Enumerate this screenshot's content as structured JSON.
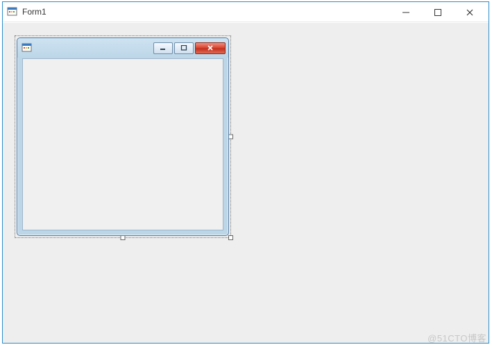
{
  "outer_window": {
    "title": "Form1",
    "icon_name": "winforms-app-icon",
    "controls": {
      "minimize_tooltip": "Minimize",
      "maximize_tooltip": "Maximize",
      "close_tooltip": "Close"
    }
  },
  "inner_window": {
    "title": "",
    "icon_name": "winforms-app-icon",
    "controls": {
      "minimize_tooltip": "Minimize",
      "maximize_tooltip": "Maximize",
      "close_tooltip": "Close"
    }
  },
  "designer": {
    "selected": "inner_window",
    "colors": {
      "accent": "#2a8ccc",
      "aero_border": "#bcd6e8",
      "close_red": "#c8381f"
    }
  },
  "watermark": "@51CTO博客"
}
